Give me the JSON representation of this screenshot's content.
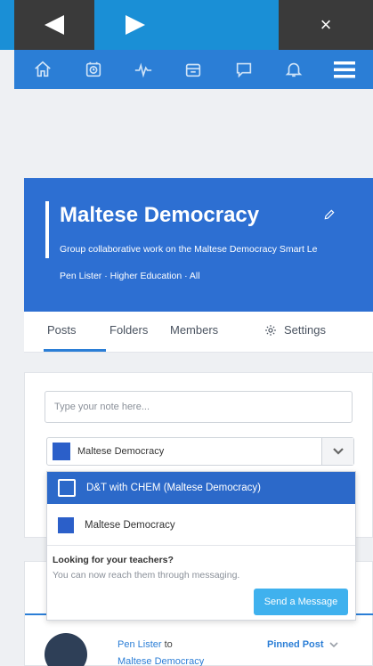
{
  "nav": {
    "back_icon": "back-arrow-icon",
    "forward_icon": "forward-arrow-icon",
    "close_label": "×"
  },
  "toolbar": {
    "icons": [
      "home-icon",
      "clock-icon",
      "activity-icon",
      "calendar-icon",
      "chat-icon",
      "bell-icon",
      "menu-icon"
    ]
  },
  "group": {
    "title": "Maltese Democracy",
    "description": "Group collaborative work on the Maltese Democracy Smart Le",
    "meta": "Pen Lister · Higher Education · All"
  },
  "tabs": {
    "posts": "Posts",
    "folders": "Folders",
    "members": "Members",
    "settings": "Settings"
  },
  "composer": {
    "placeholder": "Type your note here...",
    "selected_group": "Maltese Democracy"
  },
  "dropdown": {
    "options": [
      {
        "label": "D&T with CHEM (Maltese Democracy)"
      },
      {
        "label": "Maltese Democracy"
      }
    ],
    "heading": "Looking for your teachers?",
    "subtext": "You can now reach them through messaging.",
    "send_label": "Send a Message"
  },
  "post": {
    "author": "Pen Lister",
    "to_word": "to",
    "group": "Maltese Democracy",
    "pinned": "Pinned Post"
  },
  "colors": {
    "nav_blue": "#1a8fd6",
    "toolbar_blue": "#2b7ed6",
    "header_blue": "#2d6fd2",
    "accent_light": "#3fb1ee",
    "dark_btn": "#3a3a3a"
  }
}
